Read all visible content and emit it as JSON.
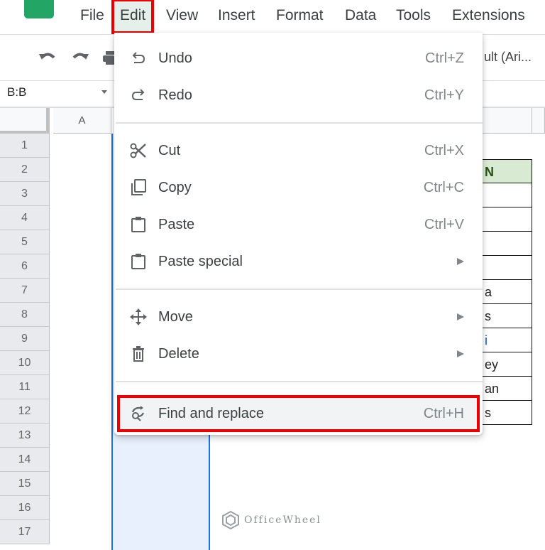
{
  "menubar": {
    "items": [
      "File",
      "Edit",
      "View",
      "Insert",
      "Format",
      "Data",
      "Tools",
      "Extensions"
    ],
    "active": "Edit"
  },
  "toolbar": {
    "icons": [
      "undo-icon",
      "redo-icon",
      "print-icon"
    ],
    "font_select": "ult (Ari..."
  },
  "namebox": {
    "value": "B:B"
  },
  "grid": {
    "columns": [
      "A"
    ],
    "rows": [
      "1",
      "2",
      "3",
      "4",
      "5",
      "6",
      "7",
      "8",
      "9",
      "10",
      "11",
      "12",
      "13",
      "14",
      "15",
      "16",
      "17"
    ],
    "visible_table_cells": [
      "N",
      "",
      "",
      "",
      "",
      "a",
      "s",
      "i",
      "ey",
      "an",
      "s"
    ]
  },
  "edit_menu": {
    "groups": [
      [
        {
          "icon": "undo-icon",
          "label": "Undo",
          "shortcut": "Ctrl+Z"
        },
        {
          "icon": "redo-icon",
          "label": "Redo",
          "shortcut": "Ctrl+Y"
        }
      ],
      [
        {
          "icon": "scissors-icon",
          "label": "Cut",
          "shortcut": "Ctrl+X"
        },
        {
          "icon": "copy-icon",
          "label": "Copy",
          "shortcut": "Ctrl+C"
        },
        {
          "icon": "clipboard-icon",
          "label": "Paste",
          "shortcut": "Ctrl+V"
        },
        {
          "icon": "clipboard-icon",
          "label": "Paste special",
          "submenu": true
        }
      ],
      [
        {
          "icon": "move-arrows-icon",
          "label": "Move",
          "submenu": true
        },
        {
          "icon": "trash-icon",
          "label": "Delete",
          "submenu": true
        }
      ],
      [
        {
          "icon": "find-replace-icon",
          "label": "Find and replace",
          "shortcut": "Ctrl+H",
          "highlighted": true
        }
      ]
    ]
  },
  "watermark": {
    "text": "OfficeWheel"
  },
  "colors": {
    "highlight_border": "#ee0000",
    "selection_fill": "#e8f0fe",
    "selection_border": "#1a73e8",
    "table_header_fill": "#d9ead3",
    "brand_green": "#23a566"
  }
}
